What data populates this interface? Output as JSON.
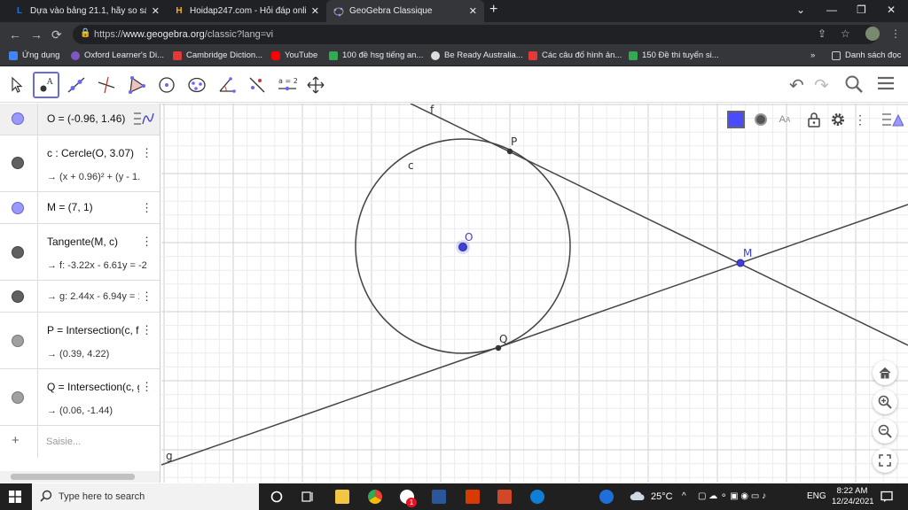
{
  "browser": {
    "tabs": [
      {
        "favicon": "L",
        "title": "Dựa vào bảng 21.1, hãy so sánh c"
      },
      {
        "favicon": "H",
        "title": "Hoidap247.com - Hỏi đáp online"
      },
      {
        "favicon": "geogebra-icon",
        "title": "GeoGebra Classique"
      }
    ],
    "url_prefix": "https://",
    "url_host": "www.geogebra.org",
    "url_path": "/classic?lang=vi",
    "bookmarks": [
      {
        "label": "Ứng dụng",
        "color": "#4285f4"
      },
      {
        "label": "Oxford Learner's Di...",
        "color": "#7e57c2"
      },
      {
        "label": "Cambridge Diction...",
        "color": "#e53935"
      },
      {
        "label": "YouTube",
        "color": "#ff0000"
      },
      {
        "label": "100 đề hsg tiếng an...",
        "color": "#34a853"
      },
      {
        "label": "Be Ready Australia...",
        "color": "#dddddd"
      },
      {
        "label": "Các câu đố hình ản...",
        "color": "#e53935"
      },
      {
        "label": "150 Đề thi tuyển si...",
        "color": "#34a853"
      }
    ],
    "bookmarks_more": "»",
    "reading_list": "Danh sách đọc"
  },
  "geogebra": {
    "algebra": [
      {
        "line1": "O = (-0.96, 1.46)",
        "marker": "#9999ff",
        "has_dots": false
      },
      {
        "line1": "c : Cercle(O, 3.07)",
        "line2": "→  (x + 0.96)² + (y - 1.",
        "marker": "#606060",
        "has_dots": true
      },
      {
        "line1": "M = (7, 1)",
        "marker": "#9999ff",
        "has_dots": true
      },
      {
        "line1": "Tangente(M, c)",
        "line2": "→  f: -3.22x - 6.61y = -2",
        "marker": "#606060",
        "has_dots": true
      },
      {
        "line2": "→  g: 2.44x - 6.94y = 10",
        "marker": "#606060",
        "has_dots": true
      },
      {
        "line1": "P = Intersection(c, f, 1",
        "line2": "→  (0.39, 4.22)",
        "marker": "#a0a0a0",
        "has_dots": true
      },
      {
        "line1": "Q = Intersection(c, g, 1",
        "line2": "→  (0.06, -1.44)",
        "marker": "#a0a0a0",
        "has_dots": true
      }
    ],
    "input_placeholder": "Saisie...",
    "equal_tool_label": "a = 2",
    "labels": {
      "c": "c",
      "O": "O",
      "P": "P",
      "Q": "Q",
      "M": "M",
      "f": "f",
      "g": "g"
    },
    "colors": {
      "point": "#4040d8",
      "line": "#444444",
      "grid_minor": "#ececec",
      "grid_major": "#cfcfcf",
      "style_color": "#4a4aff"
    }
  },
  "taskbar": {
    "search_placeholder": "Type here to search",
    "weather": "25°C",
    "language": "ENG",
    "time": "8:22 AM",
    "date": "12/24/2021",
    "notification_count": "1"
  }
}
